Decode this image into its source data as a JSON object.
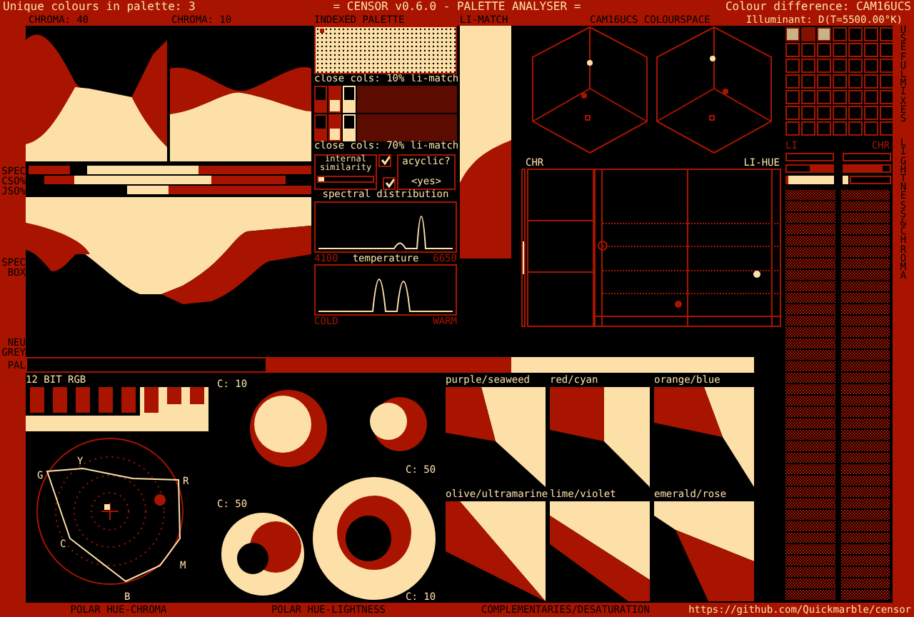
{
  "header": {
    "palette_count": "Unique colours in palette: 3",
    "title": "= CENSOR v0.6.0 - PALETTE ANALYSER =",
    "colour_difference": "Colour difference: CAM16UCS"
  },
  "subheader": {
    "chroma_labels": [
      "CHROMA: 40",
      "CHROMA: 10"
    ],
    "indexed_palette": "INDEXED PALETTE",
    "li_match": "LI-MATCH",
    "colourspace": "CAM16UCS COLOURSPACE",
    "illuminant": "Illuminant: D(T=5500.00°K)"
  },
  "side_labels": {
    "spectrum_bars": [
      "SPEC",
      "CSO%",
      "JSO%"
    ],
    "spec_box": "SPEC BOX",
    "neutral_grey": "NEU GREY",
    "palette": "PAL"
  },
  "indexed_palette": {
    "close_cols": [
      "close cols: 10% li-match",
      "close cols: 70% li-match"
    ],
    "internal_similarity": {
      "label": "internal similarity",
      "level": 0.1,
      "checked": true
    },
    "acyclic": {
      "label": "acyclic?",
      "value": "<yes>",
      "checked": true
    },
    "spectral": {
      "title": "spectral distribution",
      "min": "4100",
      "max": "6650"
    },
    "temperature": {
      "title": "temperature",
      "cold": "COLD",
      "warm": "WARM"
    }
  },
  "colourspace": {
    "chr_label": "CHR",
    "li_hue_label": "LI-HUE"
  },
  "lightness_chroma": {
    "li_label": "LI",
    "chr_label": "CHR"
  },
  "side_titles": [
    "USEFUL MIXES",
    "LIGHTNESS & CHROMA"
  ],
  "rgb12": {
    "title": "12 BIT RGB"
  },
  "polar_hue_chroma": {
    "hues": [
      "G",
      "Y",
      "R",
      "C",
      "M",
      "B"
    ]
  },
  "polar_hue_lightness": {
    "chroma_labels": [
      "C: 10",
      "C: 50",
      "C: 50",
      "C: 10"
    ]
  },
  "complementaries": {
    "pairs": [
      "purple/seaweed",
      "red/cyan",
      "orange/blue",
      "olive/ultramarine",
      "lime/violet",
      "emerald/rose"
    ]
  },
  "footer": {
    "titles": [
      "POLAR HUE-CHROMA",
      "POLAR HUE-LIGHTNESS",
      "COMPLEMENTARIES/DESATURATION"
    ],
    "url": "https://github.com/Quickmarble/censor"
  }
}
